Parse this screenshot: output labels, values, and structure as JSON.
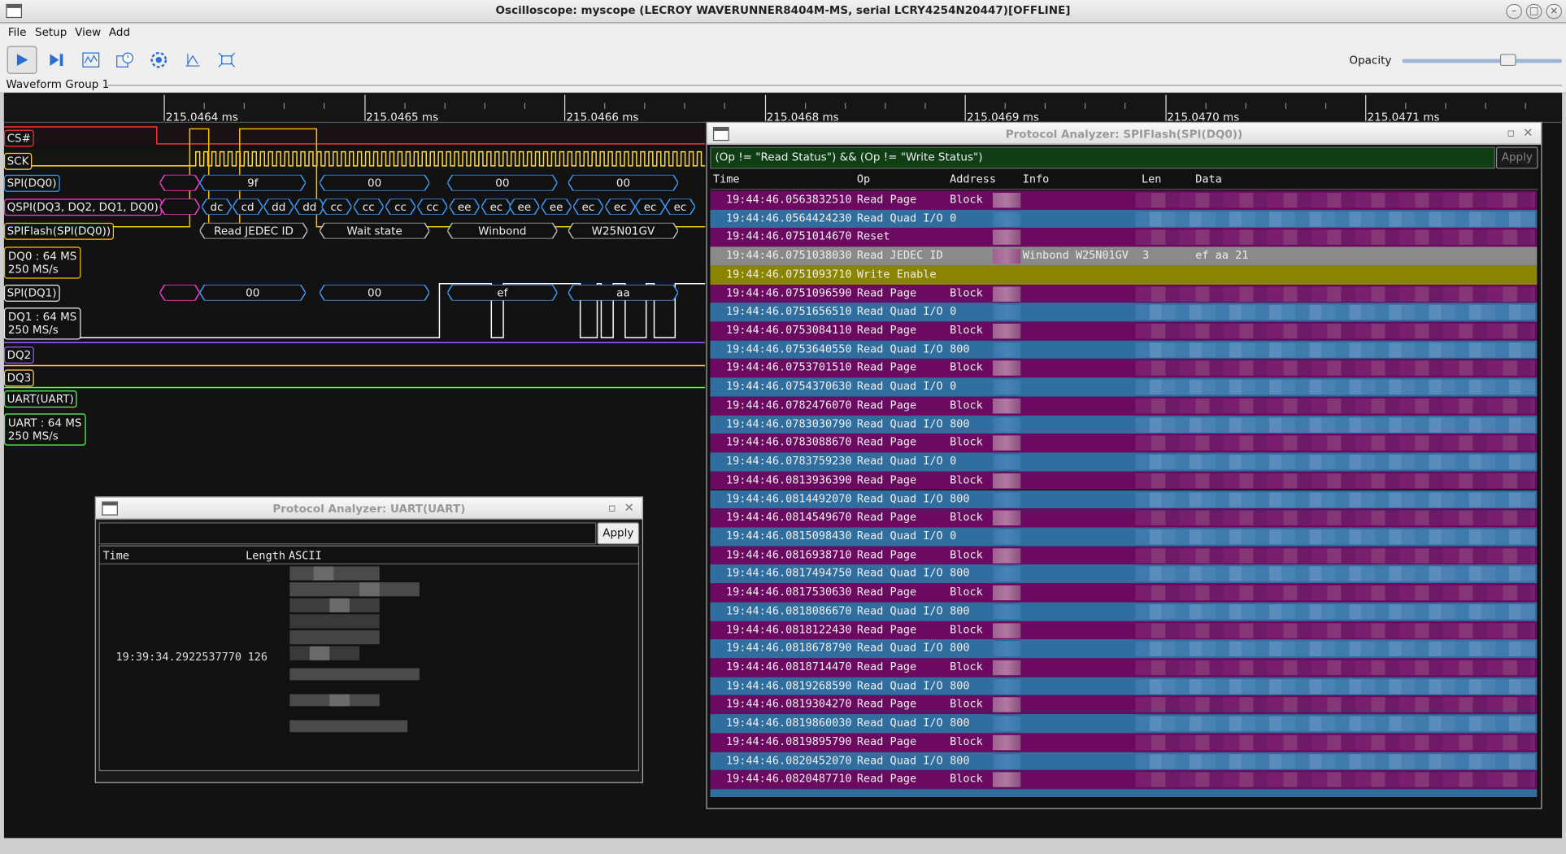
{
  "window": {
    "title": "Oscilloscope: myscope (LECROY WAVERUNNER8404M-MS, serial LCRY4254N20447)[OFFLINE]"
  },
  "menu": [
    "File",
    "Setup",
    "View",
    "Add"
  ],
  "toolbar": {
    "opacity_label": "Opacity",
    "opacity": 0.68
  },
  "group": {
    "title": "Waveform Group 1"
  },
  "ruler": {
    "labels": [
      "215.0464 ms",
      "215.0465 ms",
      "215.0466 ms",
      "215.0468 ms",
      "215.0469 ms",
      "215.0470 ms",
      "215.0471 ms"
    ]
  },
  "channels": {
    "cs": "CS#",
    "sck": "SCK",
    "dq0": "SPI(DQ0)",
    "qspi": "QSPI(DQ3, DQ2, DQ1, DQ0)",
    "flash": "SPIFlash(SPI(DQ0))",
    "dq0_analog": [
      "DQ0 : 64 MS",
      "250 MS/s"
    ],
    "dq1": "SPI(DQ1)",
    "dq1_analog": [
      "DQ1 : 64 MS",
      "250 MS/s"
    ],
    "dq2": "DQ2",
    "dq3": "DQ3",
    "uart": "UART(UART)",
    "uart_analog": [
      "UART : 64 MS",
      "250 MS/s"
    ]
  },
  "decode": {
    "dq0": [
      "9f",
      "00",
      "00",
      "00"
    ],
    "qspi": [
      "dc",
      "cd",
      "dd",
      "dd",
      "cc",
      "cc",
      "cc",
      "cc",
      "ee",
      "ec",
      "ee",
      "ee",
      "ec",
      "ec",
      "ec",
      "ec"
    ],
    "flash": [
      "Read JEDEC ID",
      "Wait state",
      "Winbond",
      "W25N01GV"
    ],
    "dq1": [
      "00",
      "00",
      "ef",
      "aa"
    ]
  },
  "colors": {
    "cs": "#ff3030",
    "sck": "#ffd84a",
    "dq0": "#3e9eff",
    "qspi": "#ff40d0",
    "flash": "#ffbf00",
    "dq1": "#ffffff",
    "dq2": "#9a5cff",
    "dq3": "#ffd84a",
    "uart": "#60ff60",
    "row_read_page": "#6b0a60",
    "row_quad": "#2f6e9e",
    "row_jedec": "#8a8a8a",
    "row_write_enable": "#8a8400"
  },
  "uart_window": {
    "title": "Protocol Analyzer: UART(UART)",
    "filter": "",
    "apply": "Apply",
    "columns": [
      "Time",
      "Length",
      "ASCII"
    ],
    "rows": [
      {
        "time": "19:39:34.2922537770",
        "length": "126"
      }
    ]
  },
  "spi_window": {
    "title": "Protocol Analyzer: SPIFlash(SPI(DQ0))",
    "filter": "(Op != \"Read Status\") && (Op != \"Write Status\")",
    "apply": "Apply",
    "columns": [
      "Time",
      "Op",
      "Address",
      "Info",
      "Len",
      "Data"
    ],
    "rows": [
      {
        "time": "19:44:46.0563832510",
        "op": "Read Page",
        "addr": "Block",
        "kind": "page"
      },
      {
        "time": "19:44:46.0564424230",
        "op": "Read Quad I/O",
        "addr": "0",
        "kind": "quad"
      },
      {
        "time": "19:44:46.0751014670",
        "op": "Reset",
        "addr": "",
        "kind": "page"
      },
      {
        "time": "19:44:46.0751038030",
        "op": "Read JEDEC ID",
        "addr": "",
        "info": "Winbond W25N01GV",
        "len": "3",
        "data": "ef aa 21",
        "kind": "jedec"
      },
      {
        "time": "19:44:46.0751093710",
        "op": "Write Enable",
        "addr": "",
        "kind": "we"
      },
      {
        "time": "19:44:46.0751096590",
        "op": "Read Page",
        "addr": "Block",
        "kind": "page"
      },
      {
        "time": "19:44:46.0751656510",
        "op": "Read Quad I/O",
        "addr": "0",
        "kind": "quad"
      },
      {
        "time": "19:44:46.0753084110",
        "op": "Read Page",
        "addr": "Block",
        "kind": "page"
      },
      {
        "time": "19:44:46.0753640550",
        "op": "Read Quad I/O",
        "addr": "800",
        "kind": "quad"
      },
      {
        "time": "19:44:46.0753701510",
        "op": "Read Page",
        "addr": "Block",
        "kind": "page"
      },
      {
        "time": "19:44:46.0754370630",
        "op": "Read Quad I/O",
        "addr": "0",
        "kind": "quad"
      },
      {
        "time": "19:44:46.0782476070",
        "op": "Read Page",
        "addr": "Block",
        "kind": "page"
      },
      {
        "time": "19:44:46.0783030790",
        "op": "Read Quad I/O",
        "addr": "800",
        "kind": "quad"
      },
      {
        "time": "19:44:46.0783088670",
        "op": "Read Page",
        "addr": "Block",
        "kind": "page"
      },
      {
        "time": "19:44:46.0783759230",
        "op": "Read Quad I/O",
        "addr": "0",
        "kind": "quad"
      },
      {
        "time": "19:44:46.0813936390",
        "op": "Read Page",
        "addr": "Block",
        "kind": "page"
      },
      {
        "time": "19:44:46.0814492070",
        "op": "Read Quad I/O",
        "addr": "800",
        "kind": "quad"
      },
      {
        "time": "19:44:46.0814549670",
        "op": "Read Page",
        "addr": "Block",
        "kind": "page"
      },
      {
        "time": "19:44:46.0815098430",
        "op": "Read Quad I/O",
        "addr": "0",
        "kind": "quad"
      },
      {
        "time": "19:44:46.0816938710",
        "op": "Read Page",
        "addr": "Block",
        "kind": "page"
      },
      {
        "time": "19:44:46.0817494750",
        "op": "Read Quad I/O",
        "addr": "800",
        "kind": "quad"
      },
      {
        "time": "19:44:46.0817530630",
        "op": "Read Page",
        "addr": "Block",
        "kind": "page"
      },
      {
        "time": "19:44:46.0818086670",
        "op": "Read Quad I/O",
        "addr": "800",
        "kind": "quad"
      },
      {
        "time": "19:44:46.0818122430",
        "op": "Read Page",
        "addr": "Block",
        "kind": "page"
      },
      {
        "time": "19:44:46.0818678790",
        "op": "Read Quad I/O",
        "addr": "800",
        "kind": "quad"
      },
      {
        "time": "19:44:46.0818714470",
        "op": "Read Page",
        "addr": "Block",
        "kind": "page"
      },
      {
        "time": "19:44:46.0819268590",
        "op": "Read Quad I/O",
        "addr": "800",
        "kind": "quad"
      },
      {
        "time": "19:44:46.0819304270",
        "op": "Read Page",
        "addr": "Block",
        "kind": "page"
      },
      {
        "time": "19:44:46.0819860030",
        "op": "Read Quad I/O",
        "addr": "800",
        "kind": "quad"
      },
      {
        "time": "19:44:46.0819895790",
        "op": "Read Page",
        "addr": "Block",
        "kind": "page"
      },
      {
        "time": "19:44:46.0820452070",
        "op": "Read Quad I/O",
        "addr": "800",
        "kind": "quad"
      },
      {
        "time": "19:44:46.0820487710",
        "op": "Read Page",
        "addr": "Block",
        "kind": "page"
      }
    ]
  }
}
